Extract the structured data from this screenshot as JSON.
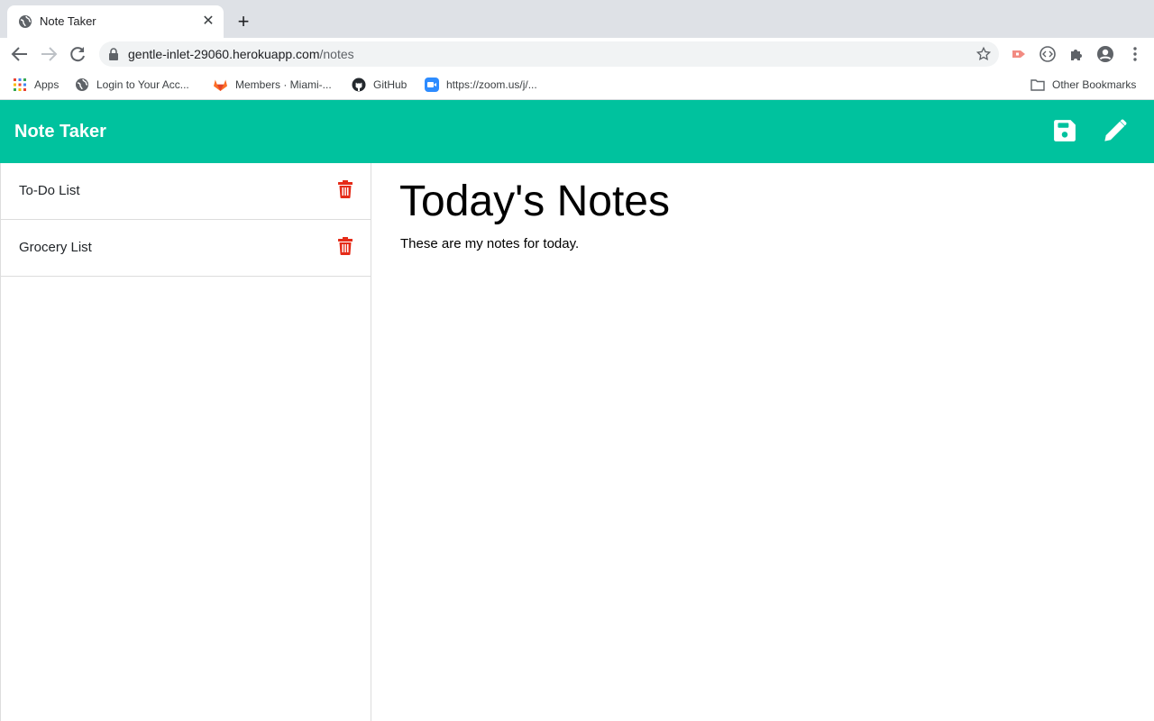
{
  "browser": {
    "tab": {
      "title": "Note Taker",
      "close_glyph": "✕"
    },
    "new_tab_glyph": "+",
    "url": {
      "host": "gentle-inlet-29060.herokuapp.com",
      "path": "/notes"
    },
    "bookmarks": [
      {
        "label": "Apps",
        "icon": "apps-grid-icon"
      },
      {
        "label": "Login to Your Acc...",
        "icon": "globe-icon"
      },
      {
        "label": "Members · Miami-...",
        "icon": "gitlab-icon"
      },
      {
        "label": "GitHub",
        "icon": "github-icon"
      },
      {
        "label": "https://zoom.us/j/...",
        "icon": "zoom-icon"
      }
    ],
    "other_bookmarks": "Other Bookmarks"
  },
  "app": {
    "brand": "Note Taker",
    "actions": {
      "save_icon": "floppy-disk-icon",
      "new_note_icon": "pencil-icon"
    },
    "colors": {
      "navbar": "#00c29e",
      "delete": "#e52b18"
    }
  },
  "notes": [
    {
      "title": "To-Do List"
    },
    {
      "title": "Grocery List"
    }
  ],
  "active_note": {
    "title": "Today's Notes",
    "text": "These are my notes for today."
  }
}
